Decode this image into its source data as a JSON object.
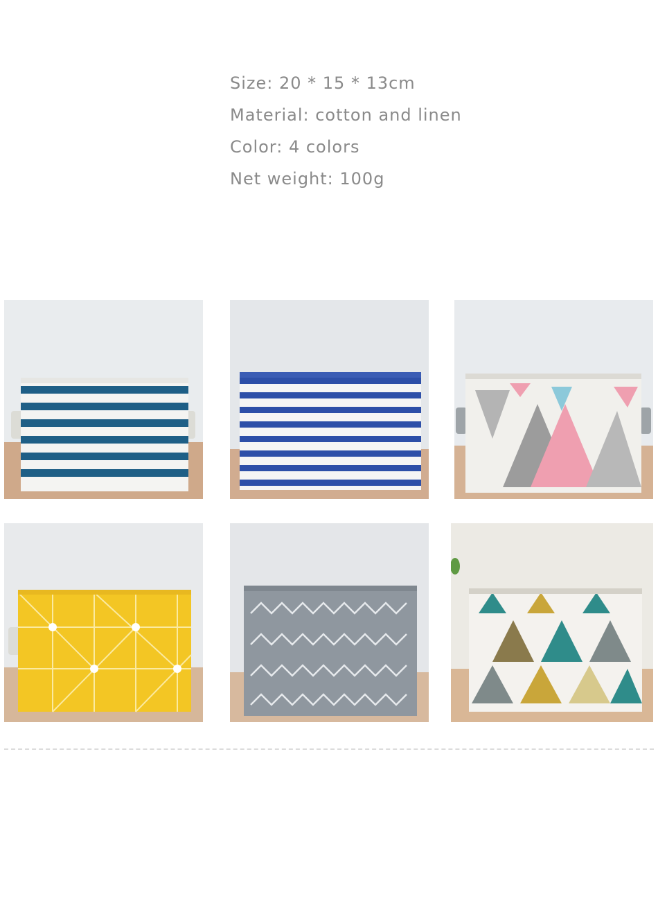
{
  "specs": [
    "Size: 20 * 15 * 13cm",
    "Material: cotton and linen",
    "Color: 4 colors",
    "Net weight: 100g"
  ],
  "products": [
    {
      "name": "teal-stripe-basket",
      "pattern": "stripes",
      "color": "#1f5f86"
    },
    {
      "name": "blue-stripe-basket",
      "pattern": "stripes",
      "color": "#2d4fa8"
    },
    {
      "name": "pastel-triangle-basket",
      "pattern": "pastel-triangles",
      "color": "#e9a6b4"
    },
    {
      "name": "yellow-geometric-basket",
      "pattern": "grid-dots",
      "color": "#f3c624"
    },
    {
      "name": "grey-chevron-basket",
      "pattern": "chevron",
      "color": "#8f979f"
    },
    {
      "name": "multicolor-triangle-basket",
      "pattern": "triangles",
      "color": "#2f8c8a"
    }
  ]
}
